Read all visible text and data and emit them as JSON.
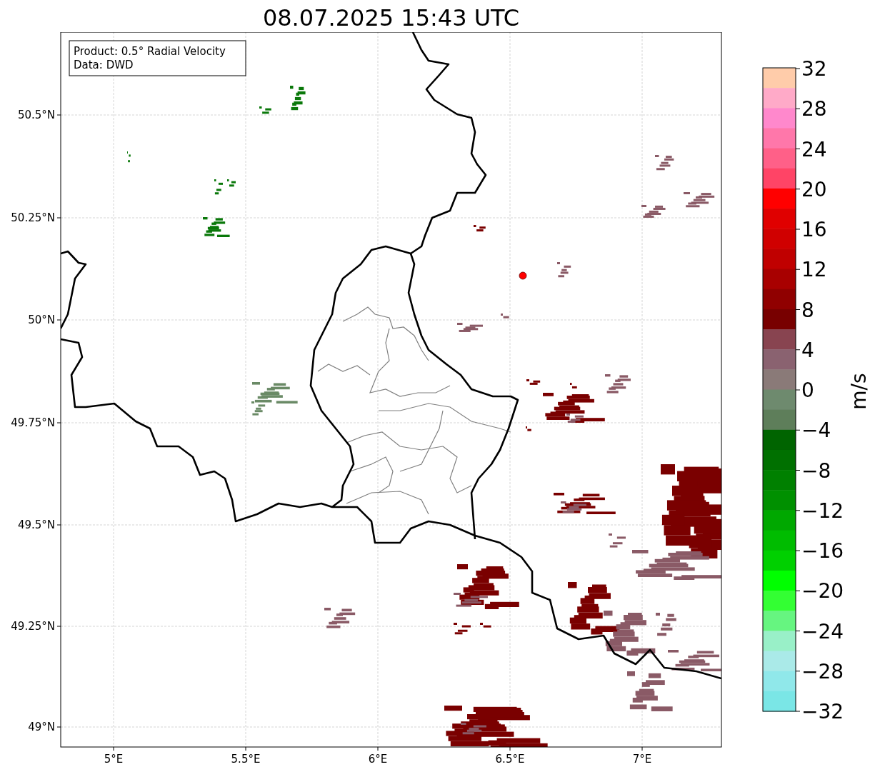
{
  "title": "08.07.2025 15:43 UTC",
  "info_box": [
    "Product: 0.5° Radial Velocity",
    "Data: DWD"
  ],
  "map": {
    "x_ticks": [
      "5°E",
      "5.5°E",
      "6°E",
      "6.5°E",
      "7°E"
    ],
    "y_ticks": [
      "50.5°N",
      "50.25°N",
      "50°N",
      "49.75°N",
      "49.5°N",
      "49.25°N",
      "49°N"
    ]
  },
  "colorbar": {
    "label": "m/s",
    "ticks": [
      "32",
      "28",
      "24",
      "20",
      "16",
      "12",
      "8",
      "4",
      "0",
      "−4",
      "−8",
      "−12",
      "−16",
      "−20",
      "−24",
      "−28",
      "−32"
    ],
    "bands": [
      {
        "color": "#ffccaa"
      },
      {
        "color": "#ffaac8"
      },
      {
        "color": "#ff88cc"
      },
      {
        "color": "#ff77aa"
      },
      {
        "color": "#ff6088"
      },
      {
        "color": "#ff4466"
      },
      {
        "color": "#ff0000"
      },
      {
        "color": "#e00000"
      },
      {
        "color": "#d00000"
      },
      {
        "color": "#c00000"
      },
      {
        "color": "#a80000"
      },
      {
        "color": "#900000"
      },
      {
        "color": "#780000"
      },
      {
        "color": "#884450"
      },
      {
        "color": "#8a6270"
      },
      {
        "color": "#8a7a78"
      },
      {
        "color": "#6e8a6e"
      },
      {
        "color": "#5e7e5a"
      },
      {
        "color": "#006400"
      },
      {
        "color": "#007000"
      },
      {
        "color": "#008000"
      },
      {
        "color": "#009000"
      },
      {
        "color": "#00a800"
      },
      {
        "color": "#00bc00"
      },
      {
        "color": "#00d000"
      },
      {
        "color": "#00ff00"
      },
      {
        "color": "#33ff33"
      },
      {
        "color": "#66f580"
      },
      {
        "color": "#99f0c8"
      },
      {
        "color": "#aaeae8"
      },
      {
        "color": "#90e8ea"
      },
      {
        "color": "#7ae6e6"
      }
    ]
  }
}
